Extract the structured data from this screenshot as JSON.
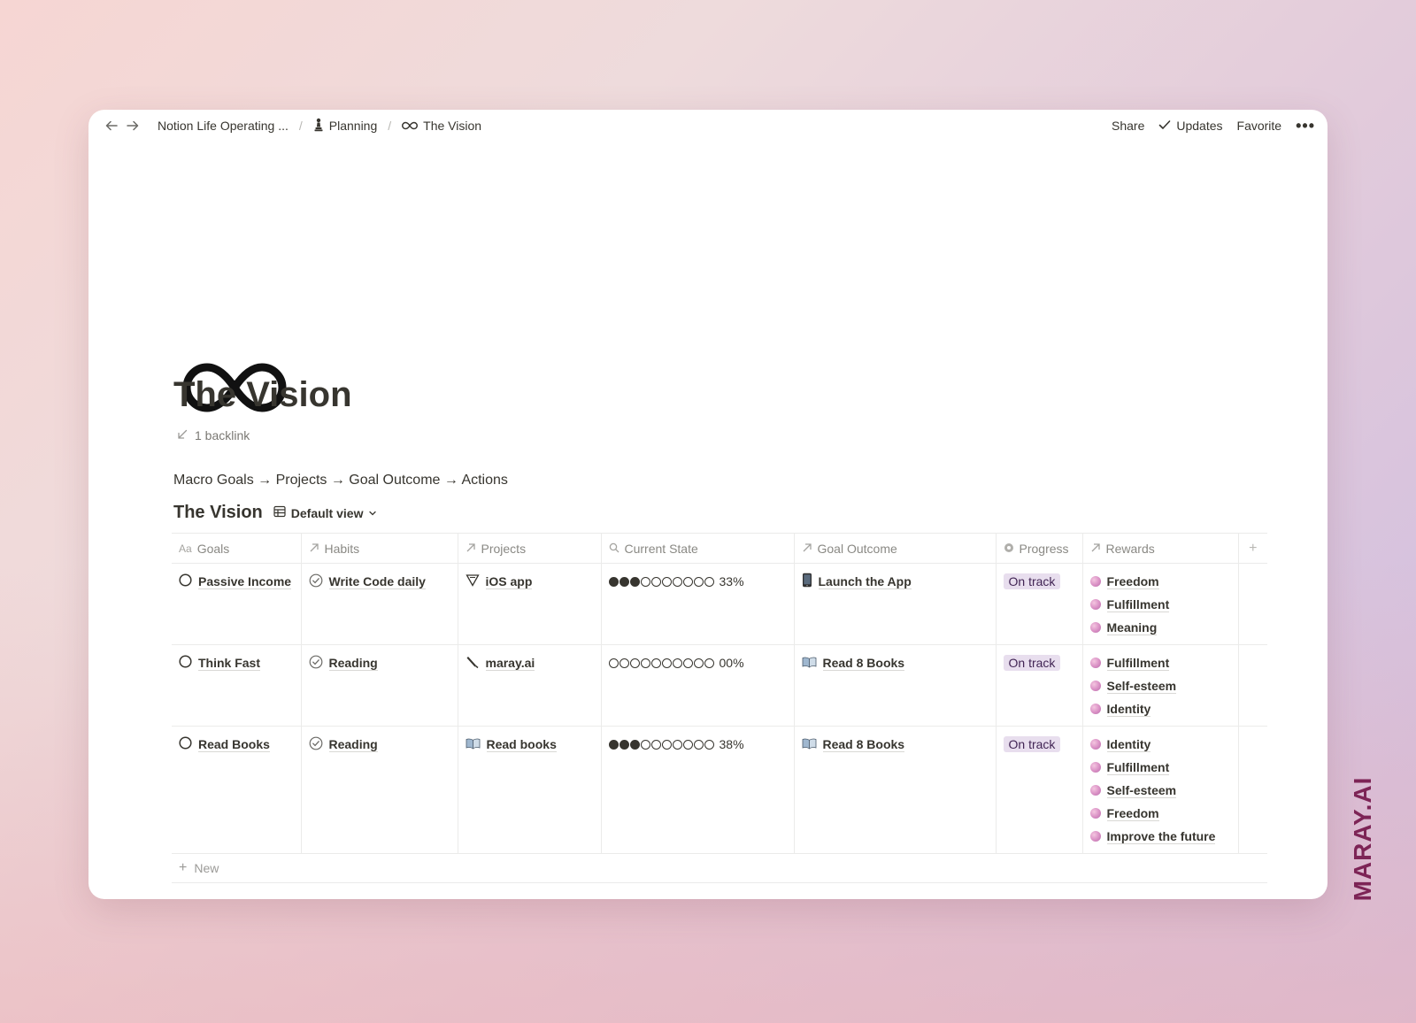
{
  "topbar": {
    "breadcrumbs": [
      {
        "label": "Notion Life Operating ...",
        "icon": "none"
      },
      {
        "label": "Planning",
        "icon": "chess-pawn-icon"
      },
      {
        "label": "The Vision",
        "icon": "infinity-icon"
      }
    ],
    "share_label": "Share",
    "updates_label": "Updates",
    "favorite_label": "Favorite"
  },
  "page": {
    "title": "The Vision",
    "icon": "infinity-icon",
    "backlink": "1 backlink",
    "flow_text": "Macro Goals → Projects → Goal Outcome → Actions"
  },
  "database": {
    "title": "The Vision",
    "view_label": "Default view",
    "columns": [
      {
        "label": "Goals",
        "icon": "text-aa-icon"
      },
      {
        "label": "Habits",
        "icon": "relation-arrow-icon"
      },
      {
        "label": "Projects",
        "icon": "relation-arrow-icon"
      },
      {
        "label": "Current State",
        "icon": "search-icon"
      },
      {
        "label": "Goal Outcome",
        "icon": "relation-arrow-icon"
      },
      {
        "label": "Progress",
        "icon": "status-icon"
      },
      {
        "label": "Rewards",
        "icon": "relation-arrow-icon"
      }
    ],
    "rows": [
      {
        "goal": "Passive Income",
        "habit": "Write Code daily",
        "project": "iOS app",
        "project_icon": "triangle-icon",
        "state_percent": "33%",
        "state_filled": 3,
        "state_total": 10,
        "outcome": "Launch the App",
        "outcome_icon": "phone-icon",
        "progress": "On track",
        "rewards": [
          "Freedom",
          "Fulfillment",
          "Meaning"
        ]
      },
      {
        "goal": "Think Fast",
        "habit": "Reading",
        "project": "maray.ai",
        "project_icon": "pen-icon",
        "state_percent": "00%",
        "state_filled": 0,
        "state_total": 10,
        "outcome": "Read 8 Books",
        "outcome_icon": "book-icon",
        "progress": "On track",
        "rewards": [
          "Fulfillment",
          "Self-esteem",
          "Identity"
        ]
      },
      {
        "goal": "Read Books",
        "habit": "Reading",
        "project": "Read books",
        "project_icon": "book-icon",
        "state_percent": "38%",
        "state_filled": 3,
        "state_total": 10,
        "outcome": "Read 8 Books",
        "outcome_icon": "book-icon",
        "progress": "On track",
        "rewards": [
          "Identity",
          "Fulfillment",
          "Self-esteem",
          "Freedom",
          "Improve the future"
        ]
      }
    ],
    "new_label": "New"
  },
  "watermark": "MARAY.AI",
  "colors": {
    "tag_bg": "#e8deee",
    "tag_text": "#412454",
    "watermark": "#7d2456"
  }
}
